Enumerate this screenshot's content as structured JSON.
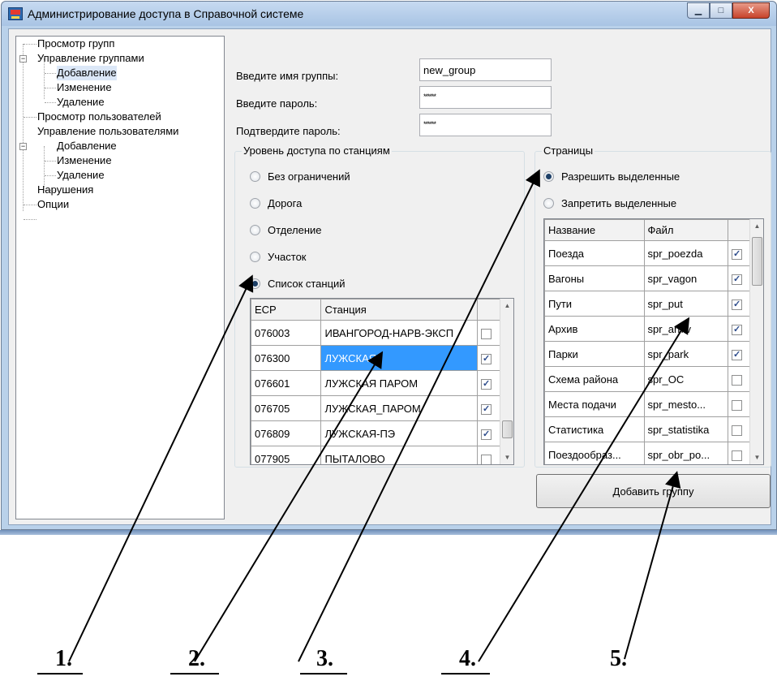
{
  "window": {
    "title": "Администрирование доступа в Справочной системе",
    "minimize_glyph": "▁",
    "maximize_glyph": "□",
    "close_glyph": "X"
  },
  "tree": {
    "items": [
      {
        "label": "Просмотр групп"
      },
      {
        "label": "Управление группами",
        "toggle": "−"
      },
      {
        "label": "Добавление"
      },
      {
        "label": "Изменение"
      },
      {
        "label": "Удаление"
      },
      {
        "label": "Просмотр пользователей"
      },
      {
        "label": "Управление пользователями",
        "toggle": "−"
      },
      {
        "label": "Добавление"
      },
      {
        "label": "Изменение"
      },
      {
        "label": "Удаление"
      },
      {
        "label": "Нарушения"
      },
      {
        "label": "Опции"
      }
    ]
  },
  "form": {
    "group_name_label": "Введите имя группы:",
    "group_name_value": "new_group",
    "password_label": "Введите пароль:",
    "password_value": "******",
    "confirm_label": "Подтвердите пароль:",
    "confirm_value": "******"
  },
  "access": {
    "legend": "Уровень доступа по станциям",
    "options": [
      "Без ограничений",
      "Дорога",
      "Отделение",
      "Участок",
      "Список станций"
    ],
    "selected": "Список станций"
  },
  "stations": {
    "headers": [
      "ЕСР",
      "Станция"
    ],
    "rows": [
      {
        "esr": "076003",
        "name": "ИВАНГОРОД-НАРВ-ЭКСП",
        "checked": false
      },
      {
        "esr": "076300",
        "name": "ЛУЖСКАЯ",
        "checked": true
      },
      {
        "esr": "076601",
        "name": "ЛУЖСКАЯ ПАРОМ",
        "checked": true
      },
      {
        "esr": "076705",
        "name": "ЛУЖСКАЯ_ПАРОМ",
        "checked": true
      },
      {
        "esr": "076809",
        "name": "ЛУЖСКАЯ-ПЭ",
        "checked": true
      },
      {
        "esr": "077905",
        "name": "ПЫТАЛОВО",
        "checked": false
      }
    ]
  },
  "pages": {
    "legend": "Страницы",
    "options": [
      "Разрешить выделенные",
      "Запретить выделенные"
    ],
    "selected": "Разрешить выделенные",
    "headers": [
      "Название",
      "Файл"
    ],
    "rows": [
      {
        "name": "Поезда",
        "file": "spr_poezda",
        "checked": true
      },
      {
        "name": "Вагоны",
        "file": "spr_vagon",
        "checked": true
      },
      {
        "name": "Пути",
        "file": "spr_put",
        "checked": true
      },
      {
        "name": "Архив",
        "file": "spr_arhiv",
        "checked": true
      },
      {
        "name": "Парки",
        "file": "spr_park",
        "checked": true
      },
      {
        "name": "Схема района",
        "file": "spr_OC",
        "checked": false
      },
      {
        "name": "Места подачи",
        "file": "spr_mesto...",
        "checked": false
      },
      {
        "name": "Статистика",
        "file": "spr_statistika",
        "checked": false
      },
      {
        "name": "Поездообраз...",
        "file": "spr_obr_po...",
        "checked": false
      }
    ]
  },
  "add_button_label": "Добавить группу",
  "callouts": [
    "1.",
    "2.",
    "3.",
    "4.",
    "5."
  ]
}
